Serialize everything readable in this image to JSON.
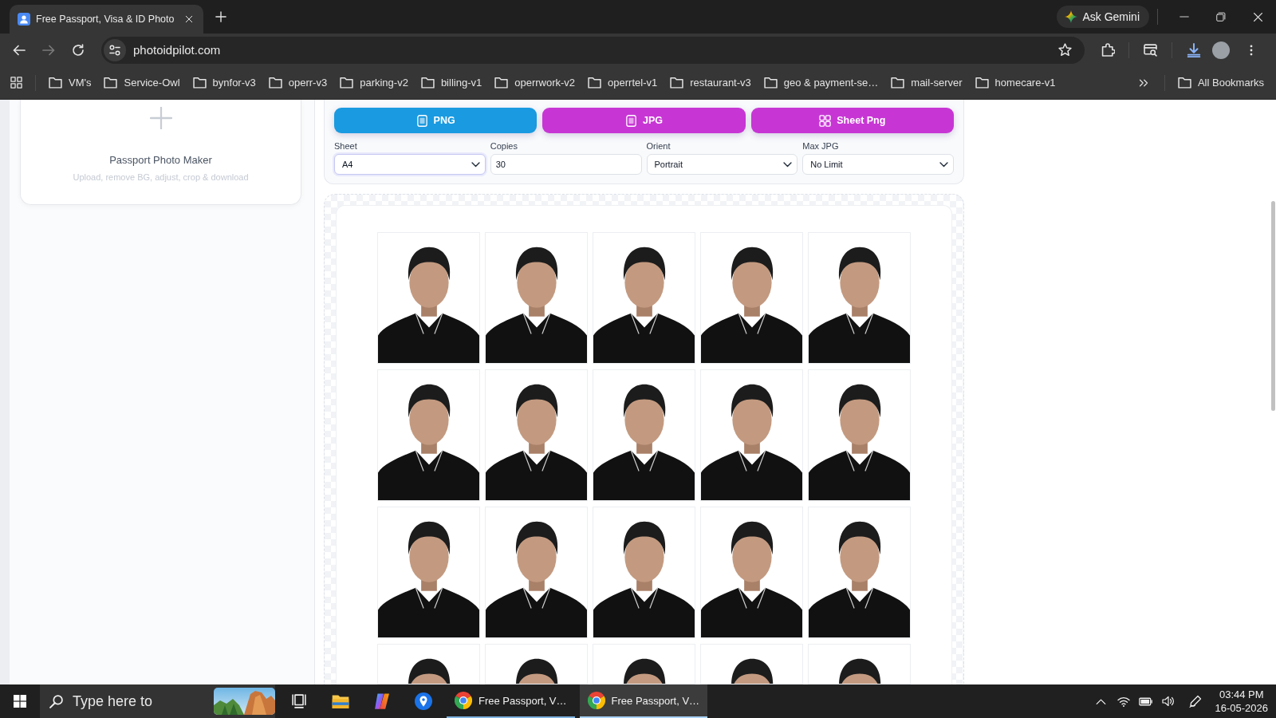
{
  "browser": {
    "tabs": [
      {
        "title": "Free Passport, Visa & ID Photo",
        "selected": true
      }
    ],
    "ask_button": "Ask Gemini",
    "nav_buttons": [
      {
        "kind": "back",
        "disabled": false
      },
      {
        "kind": "forward",
        "disabled": true
      },
      {
        "kind": "reload",
        "disabled": false
      }
    ],
    "address": "photoidpilot.com",
    "bookmarks": [
      "VM's",
      "Service-Owl",
      "bynfor-v3",
      "operr-v3",
      "parking-v2",
      "billing-v1",
      "operrwork-v2",
      "operrtel-v1",
      "restaurant-v3",
      "geo & payment-se…",
      "mail-server",
      "homecare-v1"
    ],
    "all_bookmarks": "All Bookmarks"
  },
  "sidebar": {
    "tool_card": {
      "title": "Passport Photo Maker",
      "description": "Upload, remove BG, adjust, crop & download"
    }
  },
  "export_buttons": [
    {
      "label": "PNG",
      "kind": "single",
      "color": "#1a9ae0"
    },
    {
      "label": "JPG",
      "kind": "single",
      "color": "#c736d4"
    },
    {
      "label": "Sheet Png",
      "kind": "grid",
      "color": "#c736d4"
    }
  ],
  "sheet_settings": [
    {
      "label": "Sheet",
      "kind": "select",
      "value": "A4",
      "focused": true
    },
    {
      "label": "Copies",
      "kind": "input",
      "value": "30",
      "focused": false
    },
    {
      "label": "Orient",
      "kind": "select",
      "value": "Portrait",
      "focused": false
    },
    {
      "label": "Max JPG",
      "kind": "select",
      "value": "No Limit",
      "focused": false
    }
  ],
  "taskbar": {
    "search": {
      "placeholder": "Type here to"
    },
    "apps": [
      {
        "label": "Free Passport, V…",
        "selected": false
      },
      {
        "label": "Free Passport, V…",
        "selected": true
      }
    ],
    "time": "03:44 PM",
    "date": "16-05-2026"
  }
}
